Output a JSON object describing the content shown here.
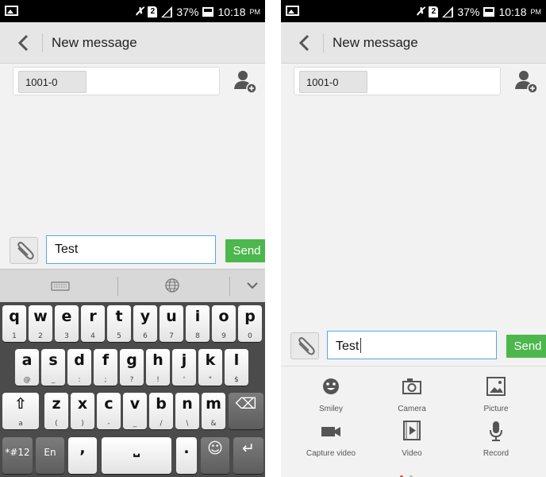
{
  "status": {
    "battery": "37%",
    "time": "10:18",
    "ampm": "PM",
    "sim_label": "2"
  },
  "title": "New message",
  "recipient": "1001-0",
  "compose": {
    "text": "Test",
    "send_label": "Send"
  },
  "keyboard": {
    "row1": [
      {
        "k": "q",
        "s": "1"
      },
      {
        "k": "w",
        "s": "2"
      },
      {
        "k": "e",
        "s": "3"
      },
      {
        "k": "r",
        "s": "4"
      },
      {
        "k": "t",
        "s": "5"
      },
      {
        "k": "y",
        "s": "6"
      },
      {
        "k": "u",
        "s": "7"
      },
      {
        "k": "i",
        "s": "8"
      },
      {
        "k": "o",
        "s": "9"
      },
      {
        "k": "p",
        "s": "0"
      }
    ],
    "row2": [
      {
        "k": "a",
        "s": "@"
      },
      {
        "k": "s",
        "s": "_"
      },
      {
        "k": "d",
        "s": ":"
      },
      {
        "k": "f",
        "s": ";"
      },
      {
        "k": "g",
        "s": "?"
      },
      {
        "k": "h",
        "s": "!"
      },
      {
        "k": "j",
        "s": "'"
      },
      {
        "k": "k",
        "s": "\""
      },
      {
        "k": "l",
        "s": "$"
      }
    ],
    "row3": [
      {
        "k": "z",
        "s": "("
      },
      {
        "k": "x",
        "s": ")"
      },
      {
        "k": "c",
        "s": "-"
      },
      {
        "k": "v",
        "s": "_"
      },
      {
        "k": "b",
        "s": "/"
      },
      {
        "k": "n",
        "s": "\\"
      },
      {
        "k": "m",
        "s": "&"
      }
    ],
    "symbols_label": "*#12",
    "lang_label": "En",
    "comma": ",",
    "period": ".",
    "shift_sub": "a"
  },
  "attachments": {
    "row1": [
      "Smiley",
      "Camera",
      "Picture"
    ],
    "row2": [
      "Capture video",
      "Video",
      "Record"
    ]
  },
  "colors": {
    "send": "#4cb74c",
    "input_border": "#55a9e6",
    "dot_active": "#e24c3f"
  }
}
